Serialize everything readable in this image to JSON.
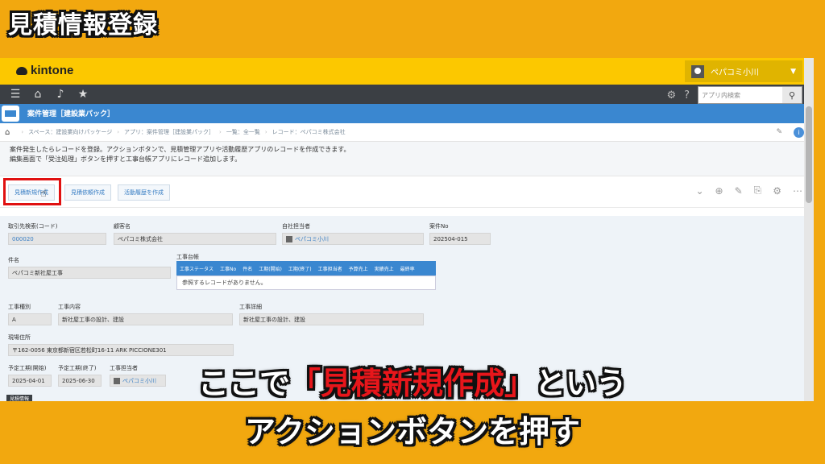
{
  "overlay_title": "見積情報登録",
  "kintone": {
    "logo": "kintone",
    "user": "ペパコミ小川",
    "search_placeholder": "アプリ内検索"
  },
  "app": {
    "title": "案件管理［建設業パック］"
  },
  "breadcrumb": {
    "space": "スペース：建設業向けパッケージ",
    "app": "アプリ：案件管理［建設業パック］",
    "view": "一覧：全一覧",
    "record": "レコード：ペパコミ株式会社"
  },
  "description": {
    "line1": "案件発生したらレコードを登録。アクションボタンで、見積管理アプリや活動履歴アプリのレコードを作成できます。",
    "line2": "編集画面で「受注処理」ボタンを押すと工事台帳アプリにレコード追加します。"
  },
  "actions": {
    "estimate_new": "見積新規作成",
    "estimate_request": "見積依頼作成",
    "activity": "活動履歴を作成"
  },
  "fields": {
    "client_label": "取引先検索(コード)",
    "client_value": "000020",
    "customer_label": "顧客名",
    "customer_value": "ペパコミ株式会社",
    "staff_label": "自社担当者",
    "staff_value": "ペパコミ小川",
    "caseno_label": "案件No",
    "caseno_value": "202504-015",
    "subject_label": "件名",
    "subject_value": "ペパコミ新社屋工事",
    "ledger_label": "工事台帳",
    "type_label": "工事種別",
    "type_value": "A",
    "content_label": "工事内容",
    "content_value": "新社屋工事の設計、建設",
    "detail_label": "工事詳細",
    "detail_value": "新社屋工事の設計、建設",
    "site_label": "現場住所",
    "site_value": "〒162-0056 東京都新宿区若松町16-11 ARK PICCIONE301",
    "start_label": "予定工期(開始)",
    "start_value": "2025-04-01",
    "end_label": "予定工期(終了)",
    "end_value": "2025-06-30",
    "cstaff_label": "工事担当者",
    "cstaff_value": "ペパコミ小川"
  },
  "ledger_table": {
    "headers": [
      "工事ステータス",
      "工事No",
      "件名",
      "工期(開始)",
      "工期(終了)",
      "工事担当者",
      "予算売上",
      "実績売上",
      "最終率"
    ],
    "empty": "参照するレコードがありません。"
  },
  "section_tag": "見積情報",
  "subtitle": {
    "pre": "ここで",
    "highlight": "「見積新規作成」",
    "post": "という",
    "line2": "アクションボタンを押す"
  }
}
